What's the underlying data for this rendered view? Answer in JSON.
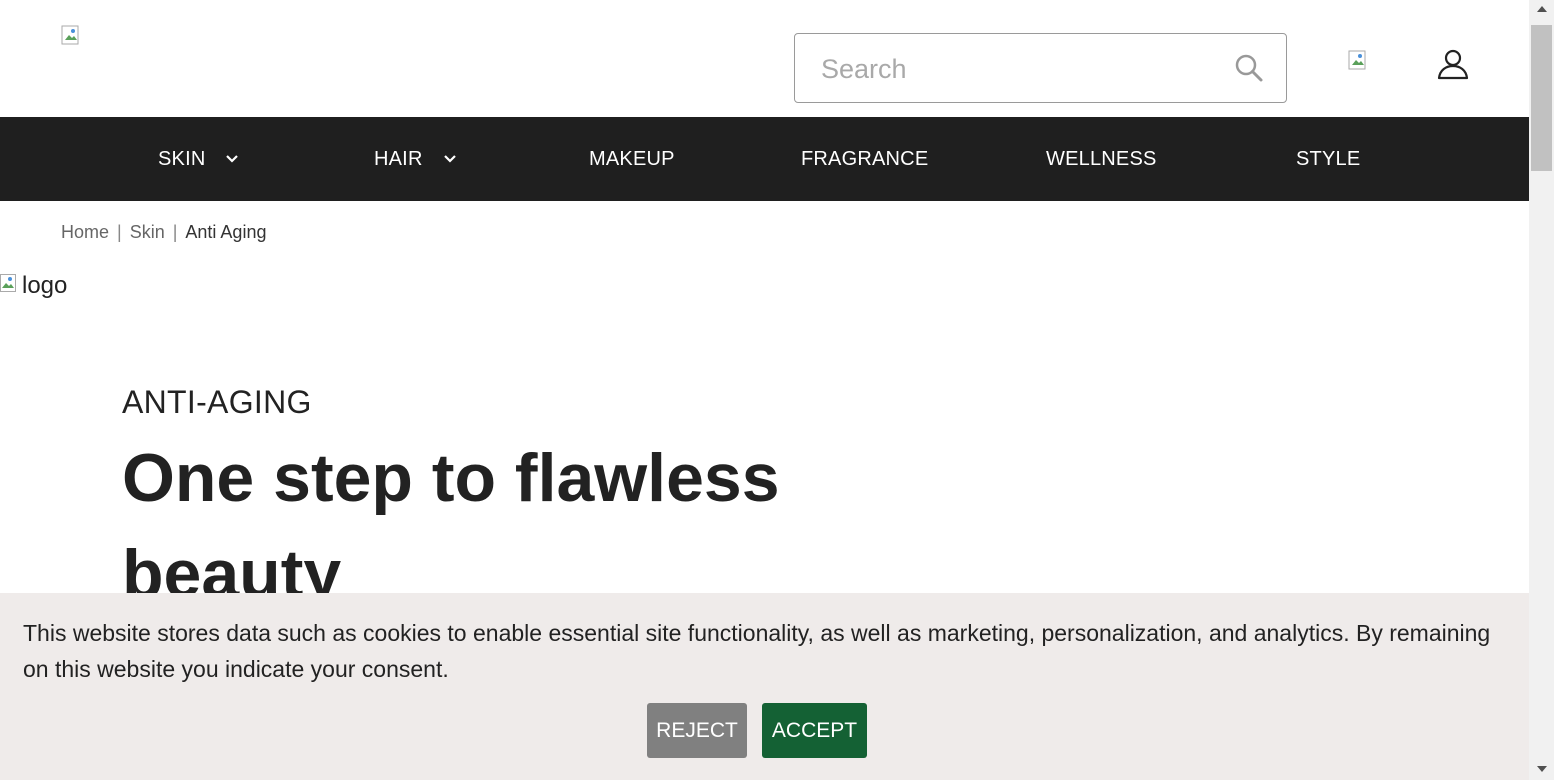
{
  "header": {
    "logo_alt": "",
    "search": {
      "placeholder": "Search",
      "value": ""
    },
    "cart_icon": "broken-image-icon",
    "account_icon": "user-icon"
  },
  "nav": {
    "items": [
      {
        "label": "SKIN",
        "has_dropdown": true
      },
      {
        "label": "HAIR",
        "has_dropdown": true
      },
      {
        "label": "MAKEUP",
        "has_dropdown": false
      },
      {
        "label": "FRAGRANCE",
        "has_dropdown": false
      },
      {
        "label": "WELLNESS",
        "has_dropdown": false
      },
      {
        "label": "STYLE",
        "has_dropdown": false
      }
    ]
  },
  "breadcrumb": {
    "items": [
      "Home",
      "Skin",
      "Anti Aging"
    ],
    "separator": "|"
  },
  "content": {
    "logo_alt": "logo",
    "eyebrow": "ANTI-AGING",
    "headline": "One step to flawless beauty"
  },
  "cookie_banner": {
    "text": "This website stores data such as cookies to enable essential site functionality, as well as marketing, personalization, and analytics. By remaining on this website you indicate your consent.",
    "reject_label": "REJECT",
    "accept_label": "ACCEPT"
  },
  "colors": {
    "nav_bg": "#1f1f1f",
    "banner_bg": "#efebea",
    "accept_bg": "#146134",
    "reject_bg": "#808080"
  }
}
